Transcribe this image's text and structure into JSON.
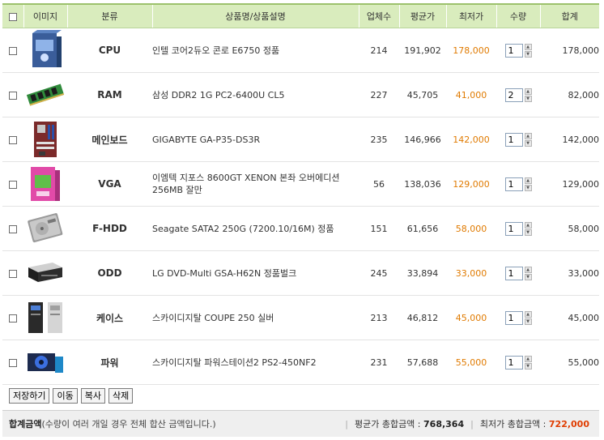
{
  "headers": {
    "image": "이미지",
    "category": "분류",
    "name": "상품명/상품설명",
    "sellers": "업체수",
    "avg_price": "평균가",
    "low_price": "최저가",
    "qty": "수량",
    "total": "합계"
  },
  "rows": [
    {
      "category": "CPU",
      "name": "인텔 코어2듀오 콘로 E6750 정품",
      "sellers": "214",
      "avg": "191,902",
      "low": "178,000",
      "qty": "1",
      "total": "178,000",
      "icon": "cpu-box-icon"
    },
    {
      "category": "RAM",
      "name": "삼성 DDR2 1G PC2-6400U CL5",
      "sellers": "227",
      "avg": "45,705",
      "low": "41,000",
      "qty": "2",
      "total": "82,000",
      "icon": "ram-module-icon"
    },
    {
      "category": "메인보드",
      "name": "GIGABYTE GA-P35-DS3R",
      "sellers": "235",
      "avg": "146,966",
      "low": "142,000",
      "qty": "1",
      "total": "142,000",
      "icon": "motherboard-icon"
    },
    {
      "category": "VGA",
      "name": "이엠텍 지포스 8600GT XENON 본좌 오버에디션 256MB 잘만",
      "sellers": "56",
      "avg": "138,036",
      "low": "129,000",
      "qty": "1",
      "total": "129,000",
      "icon": "vga-box-icon"
    },
    {
      "category": "F-HDD",
      "name": "Seagate SATA2 250G (7200.10/16M) 정품",
      "sellers": "151",
      "avg": "61,656",
      "low": "58,000",
      "qty": "1",
      "total": "58,000",
      "icon": "hdd-icon"
    },
    {
      "category": "ODD",
      "name": "LG DVD-Multi GSA-H62N 정품벌크",
      "sellers": "245",
      "avg": "33,894",
      "low": "33,000",
      "qty": "1",
      "total": "33,000",
      "icon": "dvd-drive-icon"
    },
    {
      "category": "케이스",
      "name": "스카이디지탈 COUPE 250 실버",
      "sellers": "213",
      "avg": "46,812",
      "low": "45,000",
      "qty": "1",
      "total": "45,000",
      "icon": "pc-case-icon"
    },
    {
      "category": "파워",
      "name": "스카이디지탈 파워스테이션2 PS2-450NF2",
      "sellers": "231",
      "avg": "57,688",
      "low": "55,000",
      "qty": "1",
      "total": "55,000",
      "icon": "power-supply-icon"
    }
  ],
  "buttons": {
    "save": "저장하기",
    "move": "이동",
    "copy": "복사",
    "delete": "삭제"
  },
  "summary": {
    "label": "합계금액",
    "note": "(수량이 여러 개일 경우 전체 합산 금액입니다.)",
    "avg_label": "평균가 총합금액 :",
    "avg_value": "768,364",
    "low_label": "최저가 총합금액 :",
    "low_value": "722,000"
  },
  "colors": {
    "header_bg": "#d9ecbd",
    "low_price": "#e07a00",
    "low_total": "#e03c00"
  }
}
